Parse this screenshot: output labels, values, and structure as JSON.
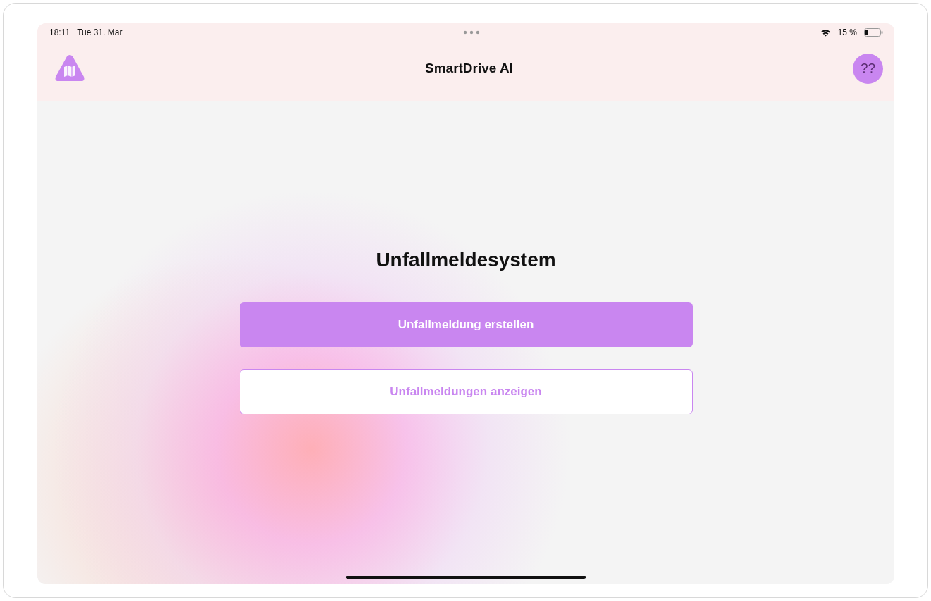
{
  "status_bar": {
    "time": "18:11",
    "date": "Tue 31. Mar",
    "battery": "15 %"
  },
  "header": {
    "title": "SmartDrive AI",
    "avatar": "??"
  },
  "main": {
    "heading": "Unfallmeldesystem",
    "buttons": [
      {
        "label": "Unfallmeldung erstellen",
        "kind": "primary"
      },
      {
        "label": "Unfallmeldungen anzeigen",
        "kind": "outline"
      }
    ]
  }
}
